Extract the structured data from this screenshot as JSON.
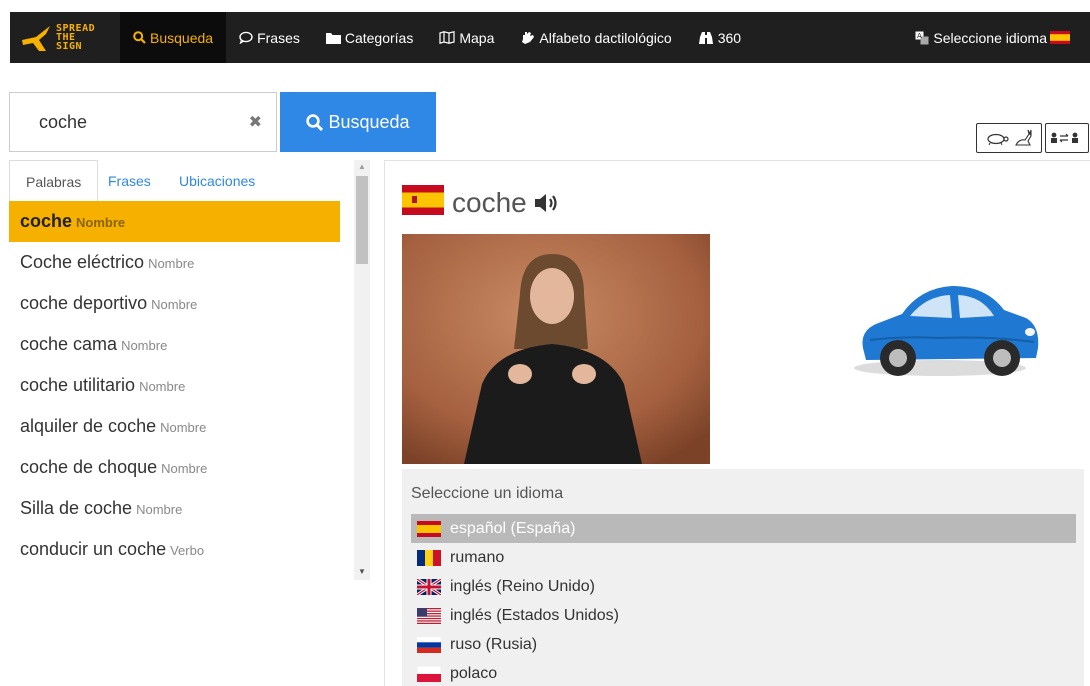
{
  "nav": {
    "logo_text": [
      "SPREAD",
      "THE",
      "SIGN"
    ],
    "items": [
      {
        "label": "Busqueda",
        "icon": "search-icon",
        "active": true
      },
      {
        "label": "Frases",
        "icon": "speech-bubble-icon"
      },
      {
        "label": "Categorías",
        "icon": "folder-icon"
      },
      {
        "label": "Mapa",
        "icon": "map-icon"
      },
      {
        "label": "Alfabeto dactilológico",
        "icon": "hand-icon"
      },
      {
        "label": "360",
        "icon": "binoculars-icon"
      }
    ],
    "language_selector": "Seleccione idioma"
  },
  "search": {
    "value": "coche",
    "button_label": "Busqueda"
  },
  "tabs": [
    "Palabras",
    "Frases",
    "Ubicaciones"
  ],
  "results": [
    {
      "word": "coche",
      "pos": "Nombre",
      "selected": true
    },
    {
      "word": "Coche eléctrico",
      "pos": "Nombre"
    },
    {
      "word": "coche deportivo",
      "pos": "Nombre"
    },
    {
      "word": "coche cama",
      "pos": "Nombre"
    },
    {
      "word": "coche utilitario",
      "pos": "Nombre"
    },
    {
      "word": "alquiler de coche",
      "pos": "Nombre"
    },
    {
      "word": "coche de choque",
      "pos": "Nombre"
    },
    {
      "word": "Silla de coche",
      "pos": "Nombre"
    },
    {
      "word": "conducir un coche",
      "pos": "Verbo"
    }
  ],
  "detail": {
    "word": "coche",
    "flag": "spain-flag-icon",
    "speaker_icon": "speaker-icon"
  },
  "languages": {
    "heading": "Seleccione un idioma",
    "items": [
      {
        "label": "español (España)",
        "flag": "spain-flag-icon",
        "selected": true
      },
      {
        "label": "rumano",
        "flag": "romania-flag-icon"
      },
      {
        "label": "inglés (Reino Unido)",
        "flag": "uk-flag-icon"
      },
      {
        "label": "inglés (Estados Unidos)",
        "flag": "usa-flag-icon"
      },
      {
        "label": "ruso (Rusia)",
        "flag": "russia-flag-icon"
      },
      {
        "label": "polaco",
        "flag": "poland-flag-icon"
      }
    ]
  },
  "colors": {
    "accent_yellow": "#f6b100",
    "button_blue": "#2f87e6",
    "navbar": "#1f1f1f"
  }
}
